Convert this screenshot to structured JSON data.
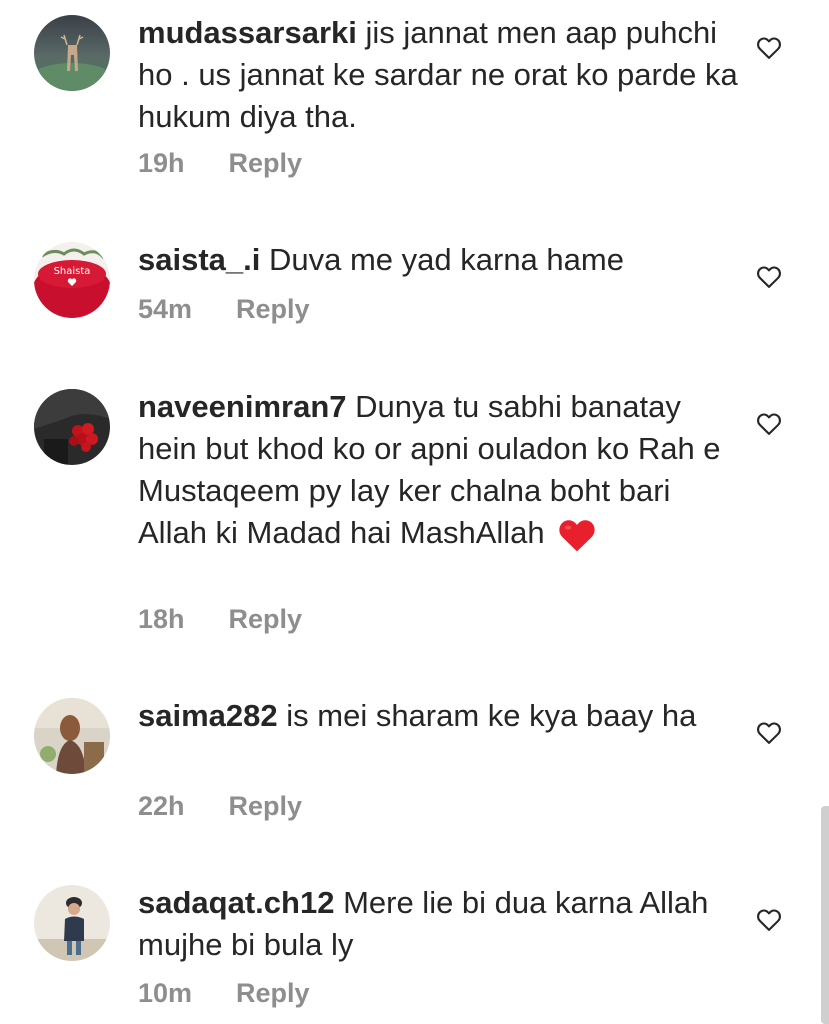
{
  "comments": [
    {
      "username": "mudassarsarki",
      "text": "jis jannat men aap puhchi ho . us jannat ke sardar ne orat ko parde ka hukum diya tha.",
      "time": "19h",
      "reply_label": "Reply",
      "avatar_icon": "deer-avatar"
    },
    {
      "username": "saista_.i",
      "text": "Duva me yad karna hame",
      "time": "54m",
      "reply_label": "Reply",
      "avatar_icon": "shaista-avatar",
      "avatar_text": "Shaista"
    },
    {
      "username": "naveenimran7",
      "text": "Dunya tu sabhi banatay hein but khod ko or apni ouladon ko  Rah e Mustaqeem py lay ker chalna boht bari Allah ki Madad hai MashAllah",
      "time": "18h",
      "reply_label": "Reply",
      "avatar_icon": "roses-avatar",
      "emoji": "red-heart-emoji"
    },
    {
      "username": "saima282",
      "text": "is mei sharam ke kya baay ha",
      "time": "22h",
      "reply_label": "Reply",
      "avatar_icon": "woman-avatar"
    },
    {
      "username": "sadaqat.ch12",
      "text": "Mere lie bi dua karna Allah mujhe bi bula ly",
      "time": "10m",
      "reply_label": "Reply",
      "avatar_icon": "child-avatar"
    }
  ],
  "colors": {
    "text": "#262626",
    "secondary": "#8e8e8e",
    "heart_emoji": "#e8202e"
  }
}
